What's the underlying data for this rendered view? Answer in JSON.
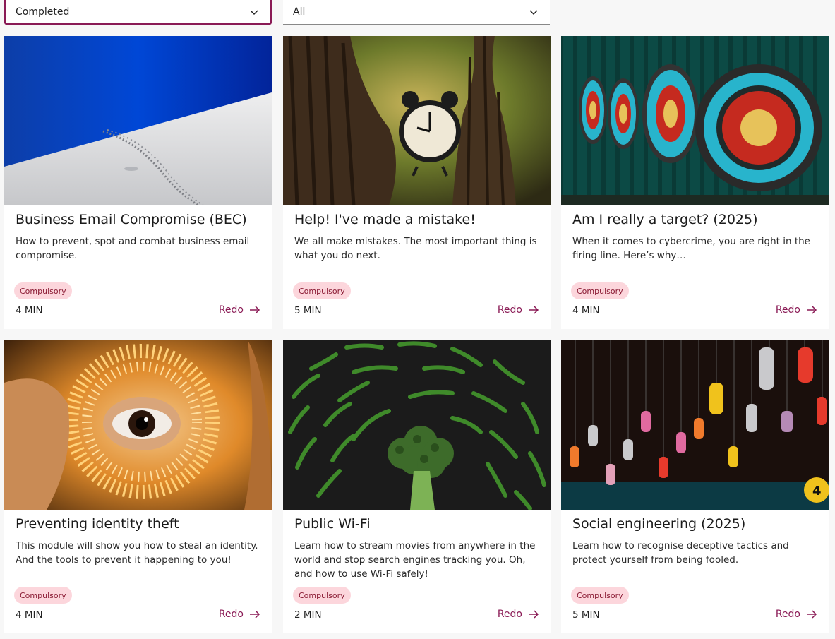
{
  "filters": {
    "status_value": "Completed",
    "type_value": "All"
  },
  "cards": [
    {
      "title": "Business Email Compromise (BEC)",
      "description": "How to prevent, spot and combat business email compromise.",
      "badge": "Compulsory",
      "duration": "4 MIN",
      "action": "Redo",
      "image": "snow-slope-footprints"
    },
    {
      "title": "Help! I've made a mistake!",
      "description": "We all make mistakes. The most important thing is what you do next.",
      "badge": "Compulsory",
      "duration": "5 MIN",
      "action": "Redo",
      "image": "alarm-clock-between-trees"
    },
    {
      "title": "Am I really a target? (2025)",
      "description": "When it comes to cybercrime, you are right in the firing line. Here’s why…",
      "badge": "Compulsory",
      "duration": "4 MIN",
      "action": "Redo",
      "image": "archery-targets"
    },
    {
      "title": "Preventing identity theft",
      "description": "This module will show you how to steal an identity. And the tools to prevent it happening to you!",
      "badge": "Compulsory",
      "duration": "4 MIN",
      "action": "Redo",
      "image": "eye-through-fairy-lights"
    },
    {
      "title": "Public Wi-Fi",
      "description": "Learn how to stream movies from anywhere in the world and stop search engines tracking you. Oh, and how to use Wi-Fi safely!",
      "badge": "Compulsory",
      "duration": "2 MIN",
      "action": "Redo",
      "image": "broccoli-green-beans"
    },
    {
      "title": "Social engineering (2025)",
      "description": "Learn how to recognise deceptive tactics and protect yourself from being fooled.",
      "badge": "Compulsory",
      "duration": "5 MIN",
      "action": "Redo",
      "image": "hanging-phone-receivers"
    }
  ],
  "colors": {
    "accent": "#8a1a55",
    "badge_bg": "#fcd6dc",
    "badge_text": "#8a1a33"
  }
}
